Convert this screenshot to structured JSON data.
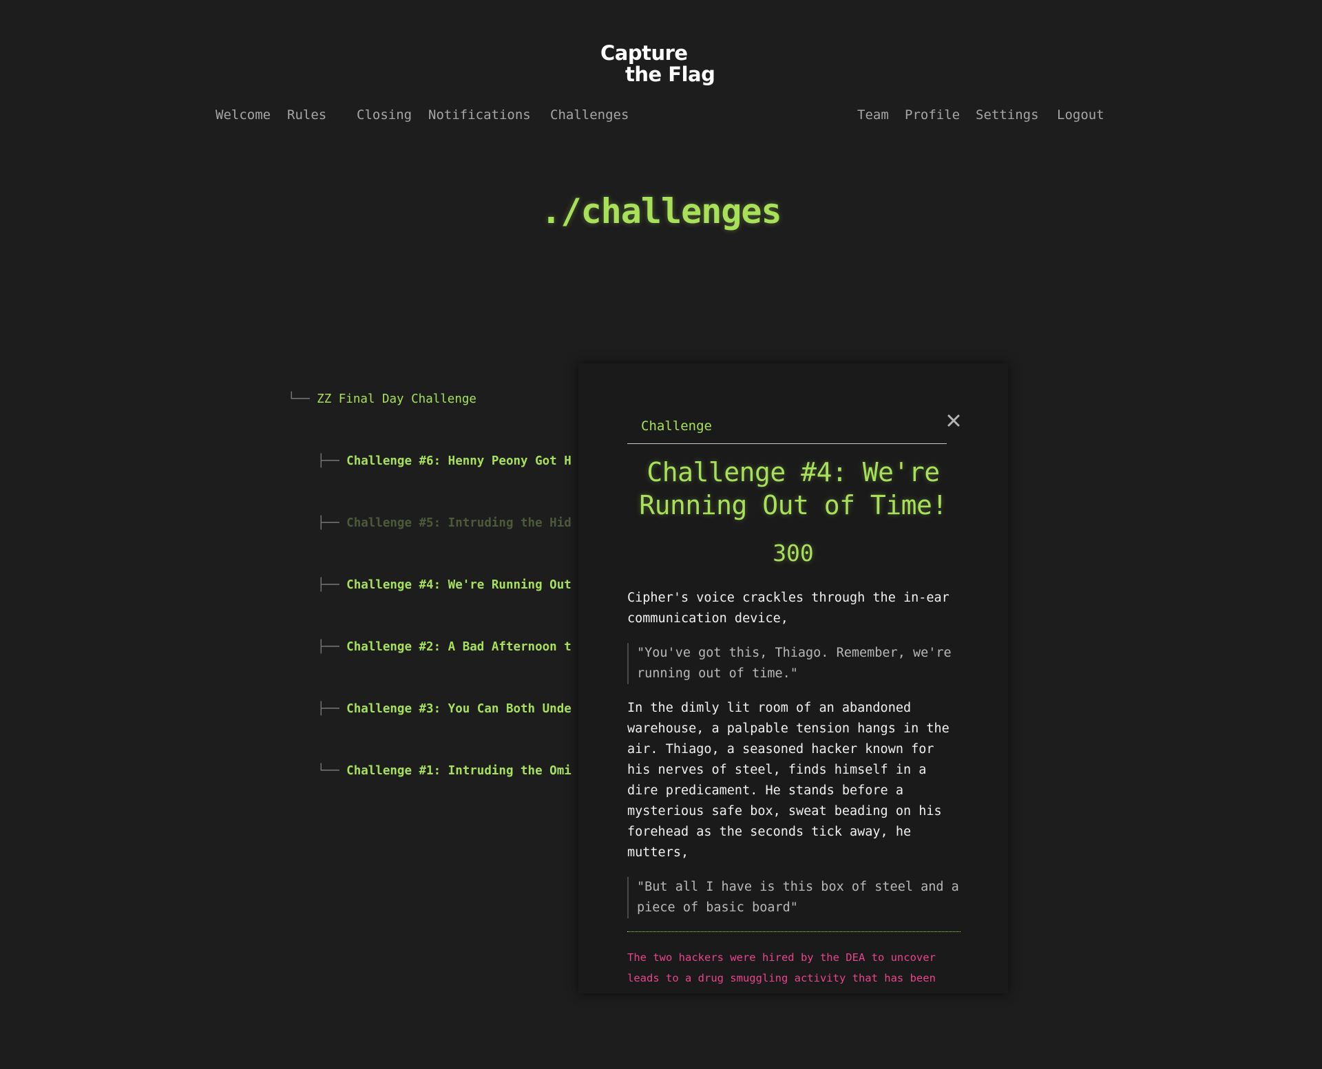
{
  "logo": {
    "line1": "Capture",
    "line2": "the Flag"
  },
  "nav": {
    "left": [
      "Welcome",
      "Rules",
      "Closing",
      "Notifications",
      "Challenges"
    ],
    "right": [
      "Team",
      "Profile",
      "Settings",
      "Logout"
    ]
  },
  "page_title": "./challenges",
  "tree": {
    "root_connector": "└──",
    "root_label": "ZZ Final Day Challenge",
    "items": [
      {
        "connector": "├──",
        "label": "Challenge #6: Henny Peony Got H",
        "solved": false
      },
      {
        "connector": "├──",
        "label": "Challenge #5: Intruding the Hid",
        "solved": true
      },
      {
        "connector": "├──",
        "label": "Challenge #4: We're Running Out",
        "solved": false
      },
      {
        "connector": "├──",
        "label": "Challenge #2: A Bad Afternoon t",
        "solved": false
      },
      {
        "connector": "├──",
        "label": "Challenge #3: You Can Both Unde",
        "solved": false
      },
      {
        "connector": "└──",
        "label": "Challenge #1: Intruding the Omi",
        "solved": false
      }
    ]
  },
  "modal": {
    "tab_label": "Challenge",
    "close_icon": "close-icon",
    "title": "Challenge #4: We're Running Out of Time!",
    "points": "300",
    "p1": "Cipher's voice crackles through the in-ear communication device,",
    "quote1": "\"You've got this, Thiago. Remember, we're running out of time.\"",
    "p2": "In the dimly lit room of an abandoned warehouse, a palpable tension hangs in the air. Thiago, a seasoned hacker known for his nerves of steel, finds himself in a dire predicament. He stands before a mysterious safe box, sweat beading on his forehead as the seconds tick away, he mutters,",
    "quote2": "\"But all I have is this box of steel and a piece of basic board\"",
    "hint": "The two hackers were hired by the DEA to uncover leads to a drug smuggling activity that has been"
  },
  "colors": {
    "background": "#1d1d1d",
    "accent_green": "#a8e05a",
    "nav_text": "#a6a6a6",
    "hint_pink": "#e8458e",
    "modal_bg": "#1a1a1a"
  }
}
